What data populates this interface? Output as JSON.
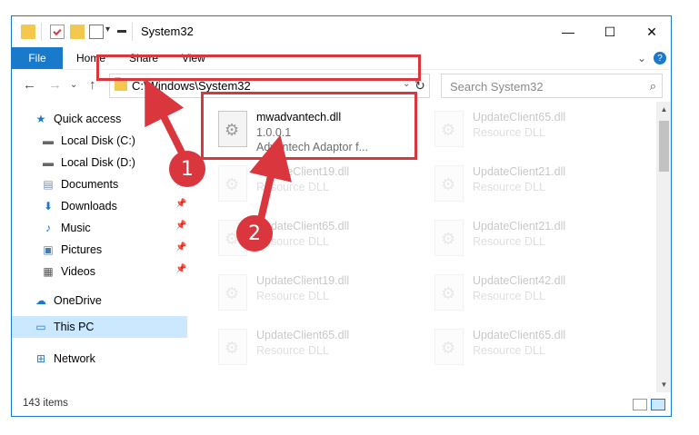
{
  "window": {
    "title": "System32",
    "qat_dropdown": "▾",
    "min": "—",
    "max": "☐",
    "close": "✕"
  },
  "ribbon": {
    "tabs": [
      "File",
      "Home",
      "Share",
      "View"
    ],
    "expand": "⌄",
    "help": "?"
  },
  "nav": {
    "back": "←",
    "forward": "→",
    "recent": "⌄",
    "up": "↑",
    "address": "C:\\Windows\\System32",
    "address_chevron": "⌄",
    "refresh": "↻",
    "search_placeholder": "Search System32",
    "search_icon": "⌕"
  },
  "sidebar": {
    "items": [
      {
        "label": "Quick access",
        "icon": "star-icon",
        "glyph": "★"
      },
      {
        "label": "Local Disk (C:)",
        "icon": "drive-icon",
        "glyph": "▬"
      },
      {
        "label": "Local Disk (D:)",
        "icon": "drive-icon",
        "glyph": "▬"
      },
      {
        "label": "Documents",
        "icon": "documents-icon",
        "glyph": "▤"
      },
      {
        "label": "Downloads",
        "icon": "downloads-icon",
        "glyph": "⬇"
      },
      {
        "label": "Music",
        "icon": "music-icon",
        "glyph": "♪"
      },
      {
        "label": "Pictures",
        "icon": "pictures-icon",
        "glyph": "▣"
      },
      {
        "label": "Videos",
        "icon": "videos-icon",
        "glyph": "▦"
      },
      {
        "label": "OneDrive",
        "icon": "cloud-icon",
        "glyph": "☁"
      },
      {
        "label": "This PC",
        "icon": "computer-icon",
        "glyph": "▭"
      },
      {
        "label": "Network",
        "icon": "network-icon",
        "glyph": "⊞"
      }
    ],
    "pin_glyph": "📌"
  },
  "files": [
    {
      "name": "mwadvantech.dll",
      "line2": "1.0.0.1",
      "line3": "Advantech Adaptor f..."
    },
    {
      "name": "UpdateClient65.dll",
      "line2": "Resource DLL"
    },
    {
      "name": "UpdateClient19.dll",
      "line2": "Resource DLL"
    },
    {
      "name": "UpdateClient21.dll",
      "line2": "Resource DLL"
    },
    {
      "name": "UpdateClient65.dll",
      "line2": "Resource DLL"
    },
    {
      "name": "UpdateClient21.dll",
      "line2": "Resource DLL"
    },
    {
      "name": "UpdateClient19.dll",
      "line2": "Resource DLL"
    },
    {
      "name": "UpdateClient42.dll",
      "line2": "Resource DLL"
    },
    {
      "name": "UpdateClient65.dll",
      "line2": "Resource DLL"
    },
    {
      "name": "UpdateClient65.dll",
      "line2": "Resource DLL"
    }
  ],
  "scroll": {
    "up": "▲",
    "down": "▼"
  },
  "status": {
    "items": "143 items"
  },
  "annotations": {
    "step1": "1",
    "step2": "2",
    "color": "#d9363e"
  },
  "colors": {
    "accent": "#1979ca",
    "selection": "#cce8ff"
  }
}
